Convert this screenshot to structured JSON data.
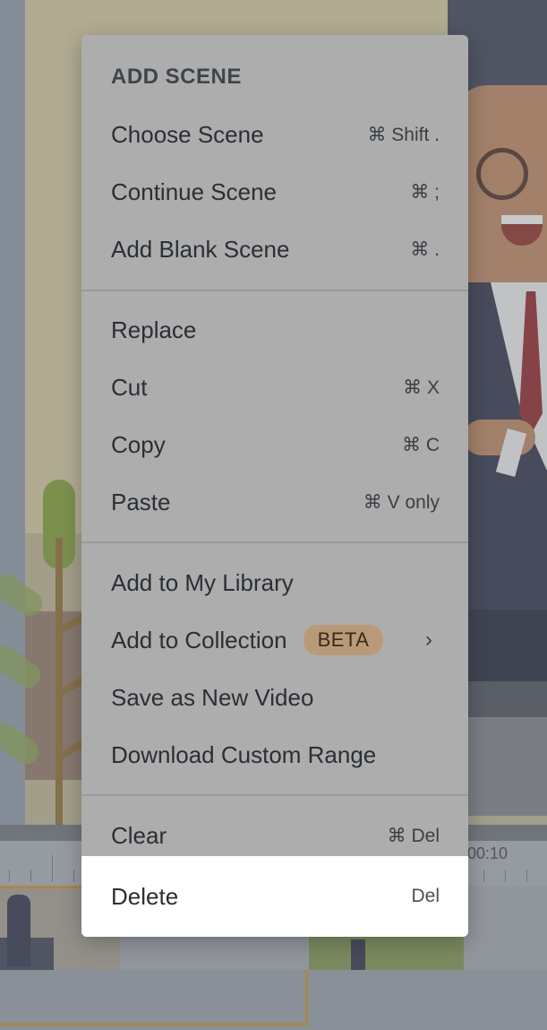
{
  "menu": {
    "header": "ADD SCENE",
    "items": [
      {
        "label": "Choose Scene",
        "shortcut": "⌘ Shift ."
      },
      {
        "label": "Continue Scene",
        "shortcut": "⌘ ;"
      },
      {
        "label": "Add Blank Scene",
        "shortcut": "⌘ ."
      },
      {
        "label": "Replace",
        "shortcut": ""
      },
      {
        "label": "Cut",
        "shortcut": "⌘ X"
      },
      {
        "label": "Copy",
        "shortcut": "⌘ C"
      },
      {
        "label": "Paste",
        "shortcut": "⌘ V only"
      },
      {
        "label": "Add to My Library",
        "shortcut": ""
      },
      {
        "label": "Add to Collection",
        "badge": "BETA",
        "chevron": "›"
      },
      {
        "label": "Save as New Video",
        "shortcut": ""
      },
      {
        "label": "Download Custom Range",
        "shortcut": ""
      },
      {
        "label": "Clear",
        "shortcut": "⌘ Del"
      },
      {
        "label": "Delete",
        "shortcut": "Del"
      }
    ]
  },
  "timeline": {
    "ruler_label": "00:10"
  },
  "colors": {
    "menu_bg": "#adadad",
    "highlight_bg": "#ffffff",
    "badge_bg": "#b99a78",
    "selection_accent": "#c28a2e"
  }
}
